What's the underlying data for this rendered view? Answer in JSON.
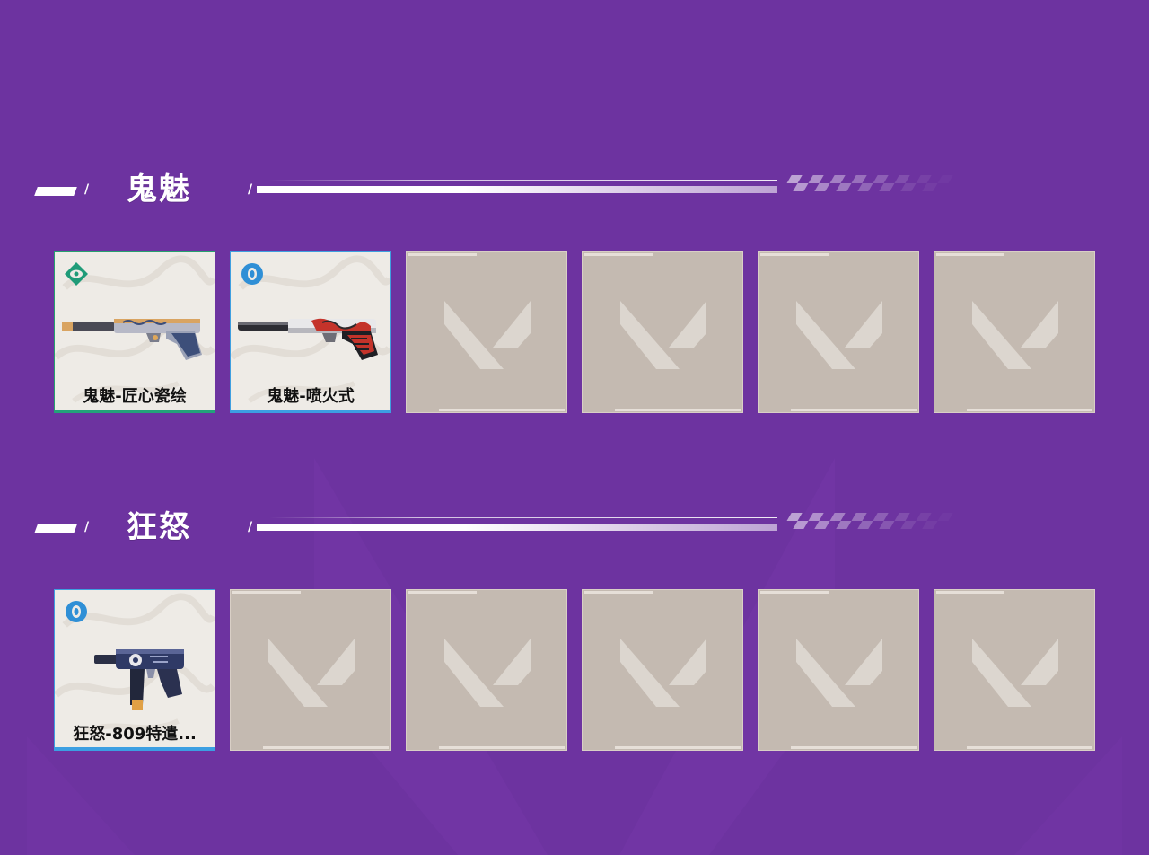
{
  "sections": [
    {
      "title": "鬼魅",
      "items": [
        {
          "name": "鬼魅-匠心瓷绘",
          "rarity_icon": "select-edition-icon",
          "rarity_color": "#1f9b78"
        },
        {
          "name": "鬼魅-喷火式",
          "rarity_icon": "deluxe-edition-icon",
          "rarity_color": "#2f8fd6"
        }
      ],
      "empty_slots": 4
    },
    {
      "title": "狂怒",
      "items": [
        {
          "name": "狂怒-809特遣...",
          "rarity_icon": "deluxe-edition-icon",
          "rarity_color": "#2f8fd6"
        }
      ],
      "empty_slots": 5
    }
  ],
  "colors": {
    "background": "#6d33a0",
    "empty_tile": "#c4bab1",
    "filled_tile": "#eeebe6"
  }
}
